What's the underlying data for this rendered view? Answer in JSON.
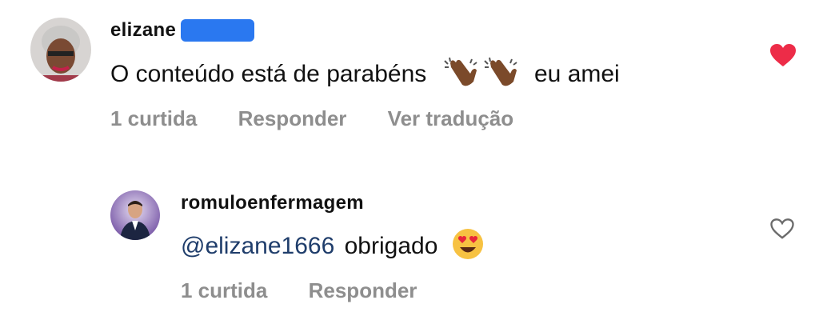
{
  "comments": [
    {
      "username": "elizane",
      "text_before": "O conteúdo está de parabéns",
      "emoji": [
        "clapping-hands-icon",
        "clapping-hands-icon"
      ],
      "text_after": "eu amei",
      "likes": "1 curtida",
      "reply": "Responder",
      "translate": "Ver tradução",
      "liked": true
    },
    {
      "username": "romuloenfermagem",
      "mention": "@elizane1666",
      "text": "obrigado",
      "emoji": "heart-eyes-icon",
      "likes": "1 curtida",
      "reply": "Responder",
      "liked": false
    }
  ],
  "colors": {
    "like_active": "#ed2c48",
    "meta": "#8e8e8e",
    "mention": "#1f3d6b"
  }
}
